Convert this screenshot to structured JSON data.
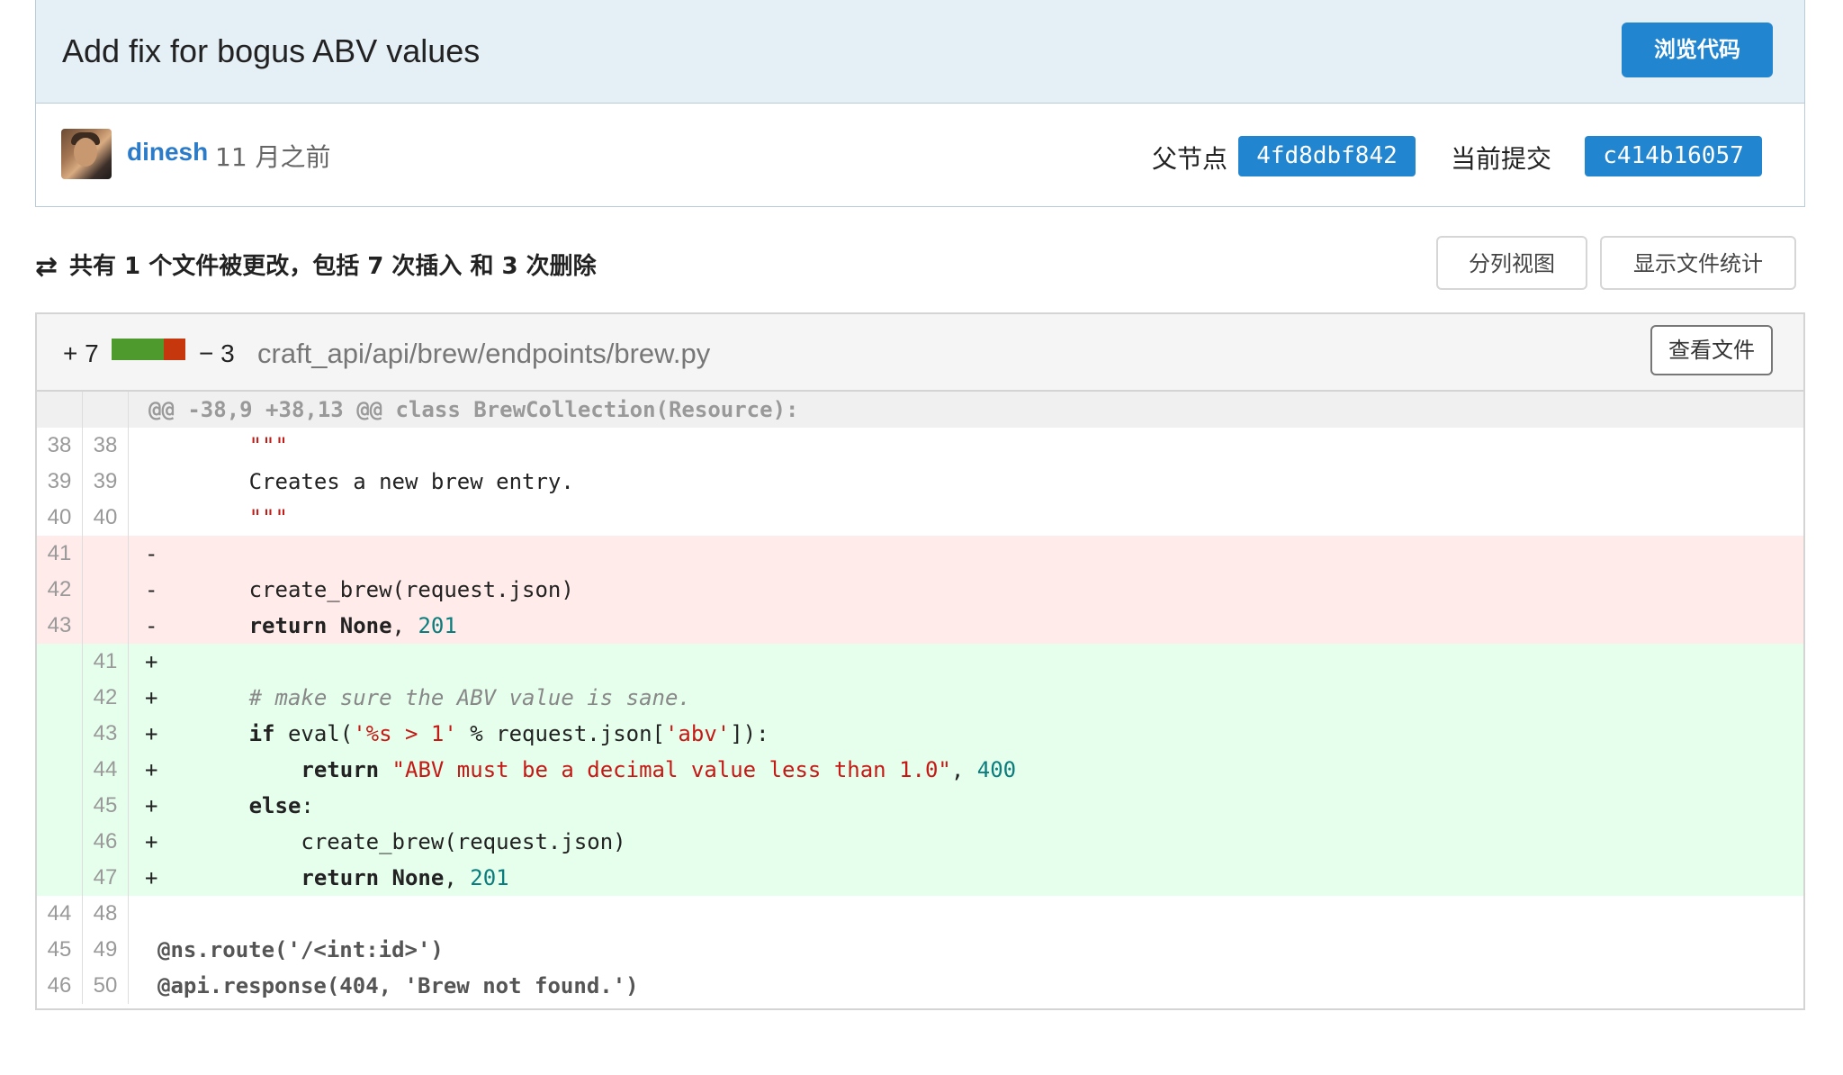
{
  "commit": {
    "title": "Add fix for bogus ABV values",
    "browse_label": "浏览代码",
    "author": "dinesh",
    "time": "11 月之前",
    "parent_label": "父节点",
    "parent_sha": "4fd8dbf842",
    "current_label": "当前提交",
    "current_sha": "c414b16057"
  },
  "stats": {
    "icon": "diff-icon",
    "summary": "共有 1 个文件被更改，包括 7 次插入 和 3 次删除",
    "split_view_label": "分列视图",
    "show_stats_label": "显示文件统计"
  },
  "file": {
    "additions": "+ 7",
    "deletions": "− 3",
    "path": "craft_api/api/brew/endpoints/brew.py",
    "view_file_label": "查看文件",
    "colors": {
      "add_bar": "#4e9a2c",
      "del_bar": "#c7370d"
    },
    "hunk_header": "@@ -38,9 +38,13 @@ class BrewCollection(Resource):",
    "lines": [
      {
        "type": "ctx",
        "old": "38",
        "new": "38",
        "segments": [
          {
            "t": "        ",
            "c": ""
          },
          {
            "t": "\"\"\"",
            "c": "tk-str"
          }
        ]
      },
      {
        "type": "ctx",
        "old": "39",
        "new": "39",
        "segments": [
          {
            "t": "        Creates a new brew entry.",
            "c": ""
          }
        ]
      },
      {
        "type": "ctx",
        "old": "40",
        "new": "40",
        "segments": [
          {
            "t": "        ",
            "c": ""
          },
          {
            "t": "\"\"\"",
            "c": "tk-str"
          }
        ]
      },
      {
        "type": "del",
        "old": "41",
        "new": "",
        "segments": [
          {
            "t": "-",
            "c": ""
          }
        ]
      },
      {
        "type": "del",
        "old": "42",
        "new": "",
        "segments": [
          {
            "t": "-       create_brew(request.json)",
            "c": ""
          }
        ]
      },
      {
        "type": "del",
        "old": "43",
        "new": "",
        "segments": [
          {
            "t": "-       ",
            "c": ""
          },
          {
            "t": "return None",
            "c": "tk-kw"
          },
          {
            "t": ", ",
            "c": ""
          },
          {
            "t": "201",
            "c": "tk-num"
          }
        ]
      },
      {
        "type": "add",
        "old": "",
        "new": "41",
        "segments": [
          {
            "t": "+",
            "c": ""
          }
        ]
      },
      {
        "type": "add",
        "old": "",
        "new": "42",
        "segments": [
          {
            "t": "+       ",
            "c": ""
          },
          {
            "t": "# make sure the ABV value is sane.",
            "c": "tk-com"
          }
        ]
      },
      {
        "type": "add",
        "old": "",
        "new": "43",
        "segments": [
          {
            "t": "+       ",
            "c": ""
          },
          {
            "t": "if",
            "c": "tk-kw"
          },
          {
            "t": " eval(",
            "c": ""
          },
          {
            "t": "'%s > 1'",
            "c": "tk-str"
          },
          {
            "t": " % request.json[",
            "c": ""
          },
          {
            "t": "'abv'",
            "c": "tk-str"
          },
          {
            "t": "]):",
            "c": ""
          }
        ]
      },
      {
        "type": "add",
        "old": "",
        "new": "44",
        "segments": [
          {
            "t": "+           ",
            "c": ""
          },
          {
            "t": "return",
            "c": "tk-kw"
          },
          {
            "t": " ",
            "c": ""
          },
          {
            "t": "\"ABV must be a decimal value less than 1.0\"",
            "c": "tk-str"
          },
          {
            "t": ", ",
            "c": ""
          },
          {
            "t": "400",
            "c": "tk-num"
          }
        ]
      },
      {
        "type": "add",
        "old": "",
        "new": "45",
        "segments": [
          {
            "t": "+       ",
            "c": ""
          },
          {
            "t": "else",
            "c": "tk-kw"
          },
          {
            "t": ":",
            "c": ""
          }
        ]
      },
      {
        "type": "add",
        "old": "",
        "new": "46",
        "segments": [
          {
            "t": "+           create_brew(request.json)",
            "c": ""
          }
        ]
      },
      {
        "type": "add",
        "old": "",
        "new": "47",
        "segments": [
          {
            "t": "+           ",
            "c": ""
          },
          {
            "t": "return None",
            "c": "tk-kw"
          },
          {
            "t": ", ",
            "c": ""
          },
          {
            "t": "201",
            "c": "tk-num"
          }
        ]
      },
      {
        "type": "ctx",
        "old": "44",
        "new": "48",
        "segments": [
          {
            "t": "",
            "c": ""
          }
        ]
      },
      {
        "type": "deco",
        "old": "45",
        "new": "49",
        "segments": [
          {
            "t": "@ns.route('/<int:id>')",
            "c": ""
          }
        ]
      },
      {
        "type": "deco",
        "old": "46",
        "new": "50",
        "segments": [
          {
            "t": "@api.response(404, 'Brew not found.')",
            "c": ""
          }
        ]
      }
    ]
  }
}
